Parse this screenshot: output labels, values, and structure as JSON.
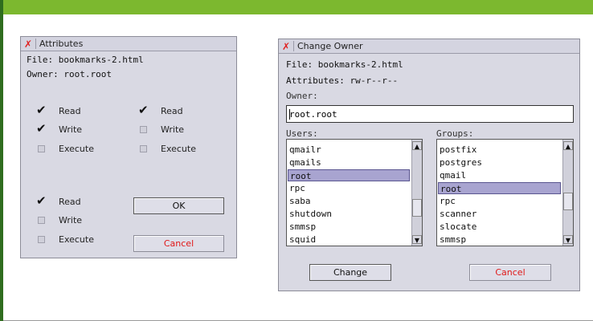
{
  "attributes": {
    "title": "Attributes",
    "file_line": "File: bookmarks-2.html",
    "owner_line": "Owner: root.root",
    "user_perms": [
      {
        "label": "Read",
        "checked": true
      },
      {
        "label": "Write",
        "checked": true
      },
      {
        "label": "Execute",
        "checked": false
      }
    ],
    "group_perms": [
      {
        "label": "Read",
        "checked": true
      },
      {
        "label": "Write",
        "checked": false
      },
      {
        "label": "Execute",
        "checked": false
      }
    ],
    "other_perms": [
      {
        "label": "Read",
        "checked": true
      },
      {
        "label": "Write",
        "checked": false
      },
      {
        "label": "Execute",
        "checked": false
      }
    ],
    "ok_label": "OK",
    "cancel_label": "Cancel"
  },
  "change_owner": {
    "title": "Change Owner",
    "file_line": "File:  bookmarks-2.html",
    "attributes_line": "Attributes: rw-r--r--",
    "owner_label": "Owner:",
    "owner_value": "root.root",
    "users_label": "Users:",
    "groups_label": "Groups:",
    "users": [
      "qmailr",
      "qmails",
      "root",
      "rpc",
      "saba",
      "shutdown",
      "smmsp",
      "squid"
    ],
    "users_selected": "root",
    "groups": [
      "postfix",
      "postgres",
      "qmail",
      "root",
      "rpc",
      "scanner",
      "slocate",
      "smmsp"
    ],
    "groups_selected": "root",
    "change_label": "Change",
    "cancel_label": "Cancel"
  },
  "icons": {
    "close": "✗",
    "check": "✔",
    "arrow_up": "▲",
    "arrow_down": "▼"
  },
  "colors": {
    "cancel_text": "#e01818",
    "selection": "#a8a4d0",
    "topbar": "#7cb82f"
  }
}
